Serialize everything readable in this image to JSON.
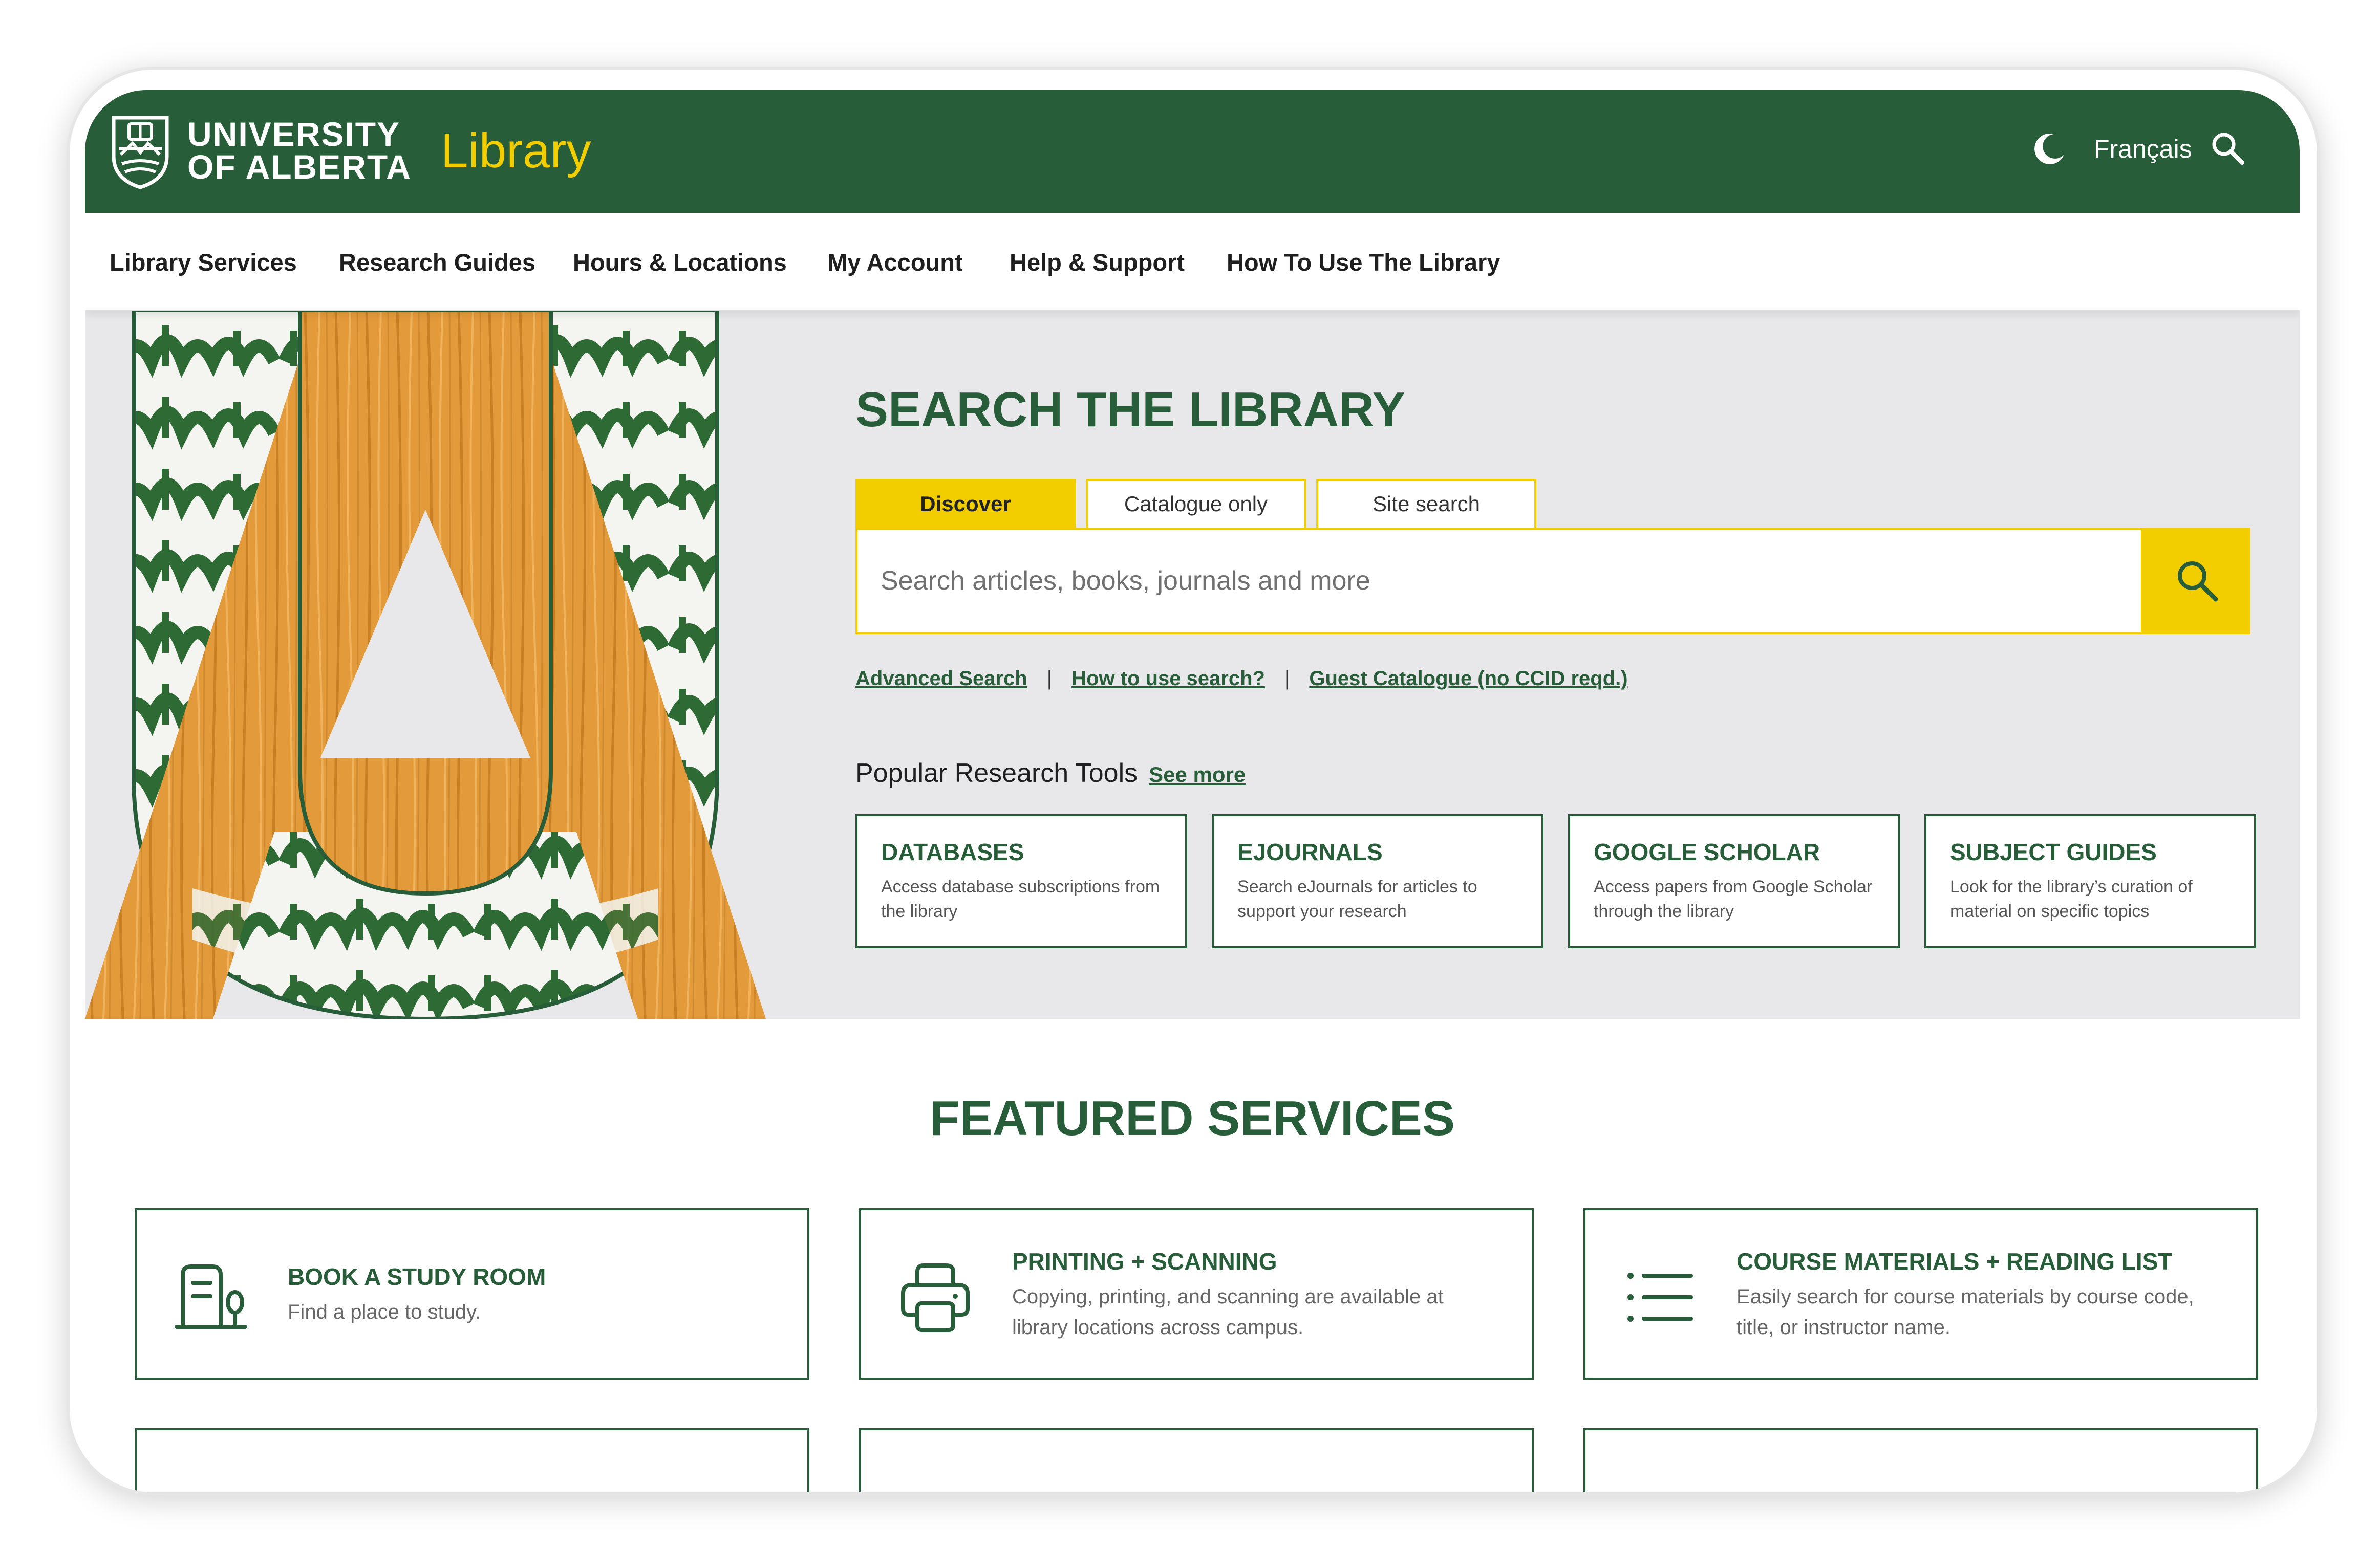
{
  "header": {
    "university_line1": "UNIVERSITY",
    "university_line2": "OF ALBERTA",
    "library": "Library",
    "language": "Français"
  },
  "nav": {
    "items": [
      {
        "label": "Library Services"
      },
      {
        "label": "Research Guides"
      },
      {
        "label": "Hours & Locations"
      },
      {
        "label": "My Account"
      },
      {
        "label": "Help & Support"
      },
      {
        "label": "How To Use The Library"
      }
    ]
  },
  "hero": {
    "title": "SEARCH THE LIBRARY",
    "tabs": [
      {
        "label": "Discover",
        "active": true
      },
      {
        "label": "Catalogue only",
        "active": false
      },
      {
        "label": "Site search",
        "active": false
      }
    ],
    "search": {
      "placeholder": "Search articles, books, journals and more",
      "value": ""
    },
    "links": [
      {
        "label": "Advanced Search"
      },
      {
        "label": "How to use search?"
      },
      {
        "label": "Guest Catalogue (no CCID reqd.)"
      }
    ],
    "popular": {
      "title": "Popular Research Tools",
      "see_more": "See more",
      "cards": [
        {
          "title": "DATABASES",
          "desc": "Access database subscriptions from the library"
        },
        {
          "title": "EJOURNALS",
          "desc": "Search eJournals for articles to support your research"
        },
        {
          "title": "GOOGLE SCHOLAR",
          "desc": "Access papers from Google Scholar through the library"
        },
        {
          "title": "SUBJECT GUIDES",
          "desc": "Look for the library’s curation of material on specific topics"
        }
      ]
    }
  },
  "featured": {
    "title": "FEATURED SERVICES",
    "cards": [
      {
        "title": "BOOK A STUDY ROOM",
        "desc": "Find a place to study.",
        "icon": "study-room-icon"
      },
      {
        "title": "PRINTING + SCANNING",
        "desc": "Copying, printing, and scanning are available at library locations across campus.",
        "icon": "printer-icon"
      },
      {
        "title": "COURSE MATERIALS + READING LIST",
        "desc": "Easily search for course materials by course code, title, or instructor name.",
        "icon": "list-icon"
      }
    ]
  },
  "colors": {
    "brand_green": "#275d38",
    "brand_gold": "#f2cd00",
    "hero_bg": "#e8e8ea"
  }
}
